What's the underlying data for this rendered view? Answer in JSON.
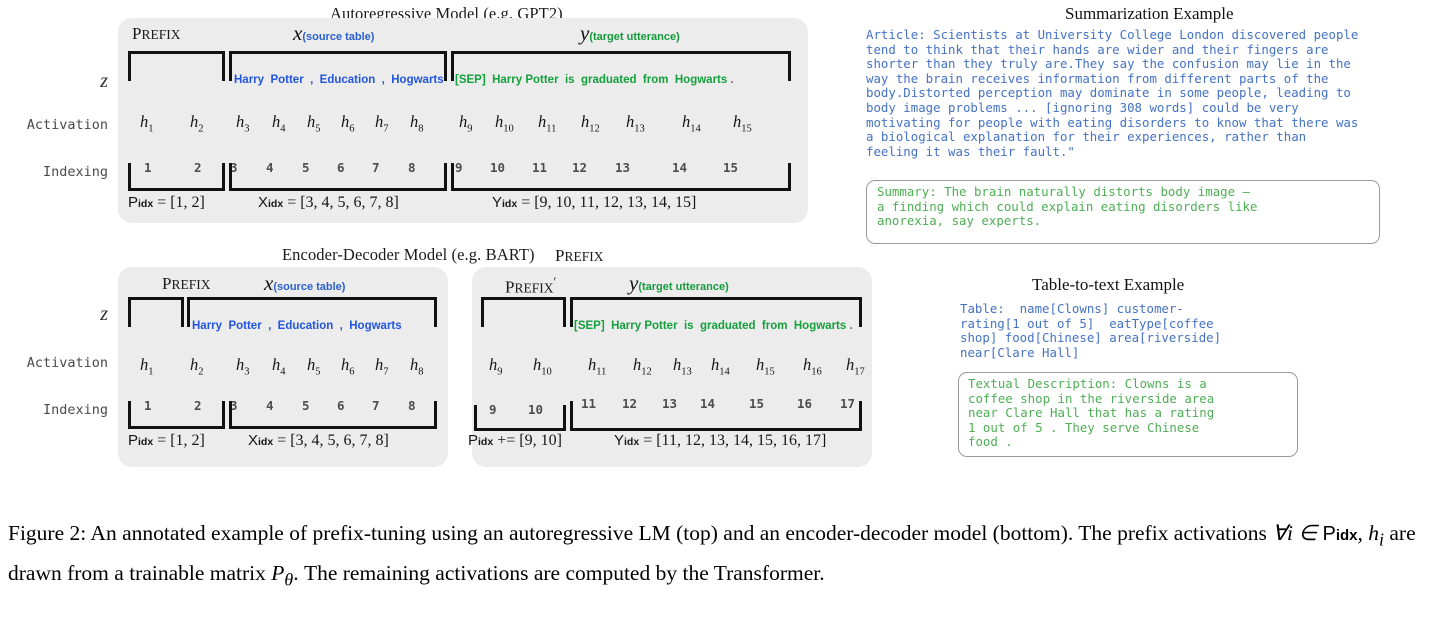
{
  "figure": {
    "caption_part1": "Figure 2:  An annotated example of prefix-tuning using an autoregressive LM (top) and an encoder-decoder model (bottom). The prefix activations ",
    "caption_forall": "∀i ∈ ",
    "caption_pidx": "P",
    "caption_pidx_sub": "idx",
    "caption_hi": ", h",
    "caption_hi_sub": "i",
    "caption_part2": " are drawn from a trainable matrix ",
    "caption_ptheta": "P",
    "caption_ptheta_sub": "θ",
    "caption_part3": ". The remaining activations are computed by the Transformer."
  },
  "top_model": {
    "title": "Autoregressive  Model  (e.g. GPT2)",
    "row_labels": {
      "z": "z",
      "activation": "Activation",
      "indexing": "Indexing"
    },
    "segments": [
      {
        "name": "Prefix",
        "label_caps": "P",
        "label_rest": "REFIX",
        "note": "",
        "note_color": ""
      },
      {
        "name": "x",
        "label_math": "x",
        "note": "(source table)",
        "note_color": "#2a5fd0"
      },
      {
        "name": "y",
        "label_math": "y",
        "note": "(target utterance)",
        "note_color": "#159b3c"
      }
    ],
    "tokens_source": [
      "Harry",
      "Potter",
      ",",
      "Education",
      ",",
      "Hogwarts"
    ],
    "tokens_target": [
      "[SEP]",
      "Harry",
      "Potter",
      "is",
      "graduated",
      "from",
      "Hogwarts"
    ],
    "tokens_target_trailing": ".",
    "activations": [
      "h1",
      "h2",
      "h3",
      "h4",
      "h5",
      "h6",
      "h7",
      "h8",
      "h9",
      "h10",
      "h11",
      "h12",
      "h13",
      "h14",
      "h15"
    ],
    "indices": [
      "1",
      "2",
      "3",
      "4",
      "5",
      "6",
      "7",
      "8",
      "9",
      "10",
      "11",
      "12",
      "13",
      "14",
      "15"
    ],
    "formulas": {
      "p": "P_idx = [1, 2]",
      "p_name": "P",
      "p_sub": "idx",
      "p_val": " = [1, 2]",
      "x_name": "X",
      "x_sub": "idx",
      "x_val": " = [3, 4, 5, 6, 7, 8]",
      "y_name": "Y",
      "y_sub": "idx",
      "y_val": " = [9, 10, 11, 12, 13, 14, 15]"
    }
  },
  "bottom_model": {
    "title": "Encoder-Decoder Model  (e.g. BART)",
    "prefix_outside_label_caps": "P",
    "prefix_outside_label_rest": "REFIX",
    "row_labels": {
      "z": "z",
      "activation": "Activation",
      "indexing": "Indexing"
    },
    "encoder": {
      "prefix_caps": "P",
      "prefix_rest": "REFIX",
      "x_math": "x",
      "x_note": "(source table)",
      "tokens": [
        "Harry",
        "Potter",
        ",",
        "Education",
        ",",
        "Hogwarts"
      ],
      "activations": [
        "h1",
        "h2",
        "h3",
        "h4",
        "h5",
        "h6",
        "h7",
        "h8"
      ],
      "indices": [
        "1",
        "2",
        "3",
        "4",
        "5",
        "6",
        "7",
        "8"
      ],
      "p_name": "P",
      "p_sub": "idx",
      "p_val": " = [1, 2]",
      "x_name": "X",
      "x_sub": "idx",
      "x_val": " = [3, 4, 5, 6, 7, 8]"
    },
    "decoder": {
      "prefix_caps": "P",
      "prefix_rest": "REFIX",
      "prefix_prime": "′",
      "y_math": "y",
      "y_note": "(target utterance)",
      "tokens": [
        "[SEP]",
        "Harry",
        "Potter",
        "is",
        "graduated",
        "from",
        "Hogwarts"
      ],
      "tokens_trailing": ".",
      "activations": [
        "h9",
        "h10",
        "h11",
        "h12",
        "h13",
        "h14",
        "h15",
        "h16",
        "h17"
      ],
      "indices": [
        "9",
        "10",
        "11",
        "12",
        "13",
        "14",
        "15",
        "16",
        "17"
      ],
      "p_name": "P",
      "p_sub": "idx",
      "p_val": " += [9, 10]",
      "y_name": "Y",
      "y_sub": "idx",
      "y_val": " = [11, 12, 13, 14, 15, 16, 17]"
    }
  },
  "summarization_example": {
    "title": "Summarization Example",
    "article": "Article: Scientists at University College London discovered people\ntend to think that their hands are wider and their fingers are\nshorter than they truly are.They say the confusion may lie in the\nway the brain receives information from different parts of the\nbody.Distorted perception may dominate in some people, leading to\nbody image problems ... [ignoring 308 words] could be very\nmotivating for people with eating disorders to know that there was\na biological explanation for their experiences, rather than\nfeeling it was their fault.\"",
    "summary": "Summary: The brain naturally distorts body image –\na finding which could explain eating disorders like\nanorexia, say experts."
  },
  "table_to_text_example": {
    "title": "Table-to-text Example",
    "table": "Table:  name[Clowns] customer-\nrating[1 out of 5]  eatType[coffee\nshop] food[Chinese] area[riverside]\nnear[Clare Hall]",
    "description": "Textual Description: Clowns is a\ncoffee shop in the riverside area\nnear Clare Hall that has a rating\n1 out of 5 . They serve Chinese\nfood ."
  },
  "colors": {
    "panel_bg": "#ececec",
    "source_blue": "#2255dd",
    "target_green": "#14a03c",
    "example_blue": "#4472c4",
    "example_green": "#4fae55",
    "bracket": "#111111"
  }
}
